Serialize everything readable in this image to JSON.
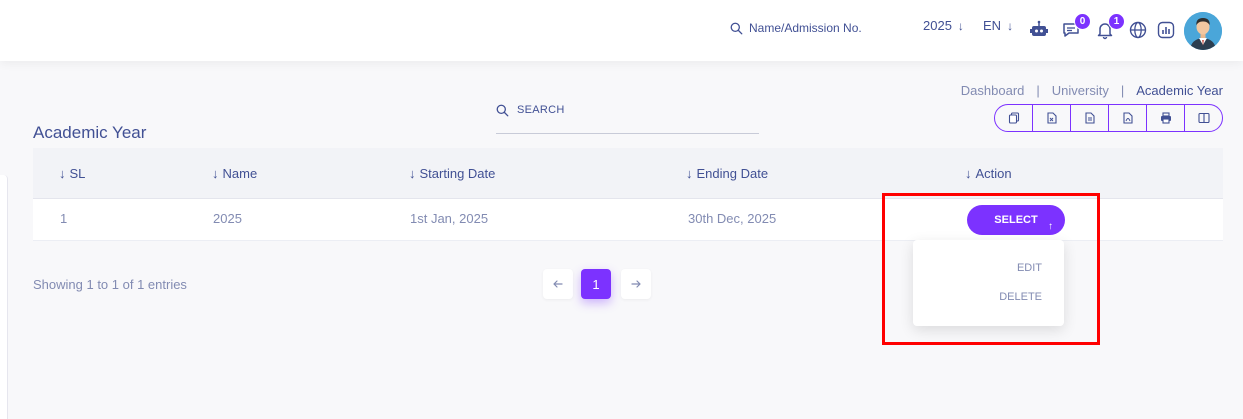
{
  "header": {
    "search_label": "Name/Admission No.",
    "year": "2025",
    "language": "EN",
    "chat_badge": "0",
    "notification_badge": "1"
  },
  "breadcrumb": {
    "items": [
      "Dashboard",
      "University",
      "Academic Year"
    ],
    "separator": "|"
  },
  "page": {
    "title": "Academic Year",
    "search_placeholder": "SEARCH"
  },
  "table": {
    "columns": [
      "SL",
      "Name",
      "Starting Date",
      "Ending Date",
      "Action"
    ],
    "rows": [
      {
        "sl": "1",
        "name": "2025",
        "start": "1st Jan, 2025",
        "end": "30th Dec, 2025",
        "action": "SELECT"
      }
    ]
  },
  "action_menu": {
    "items": [
      "EDIT",
      "DELETE"
    ]
  },
  "footer": {
    "info": "Showing 1 to 1 of 1 entries",
    "current_page": "1"
  },
  "colors": {
    "accent": "#7c32ff",
    "text": "#415094",
    "muted": "#828bb2",
    "highlight": "#ff0000"
  }
}
